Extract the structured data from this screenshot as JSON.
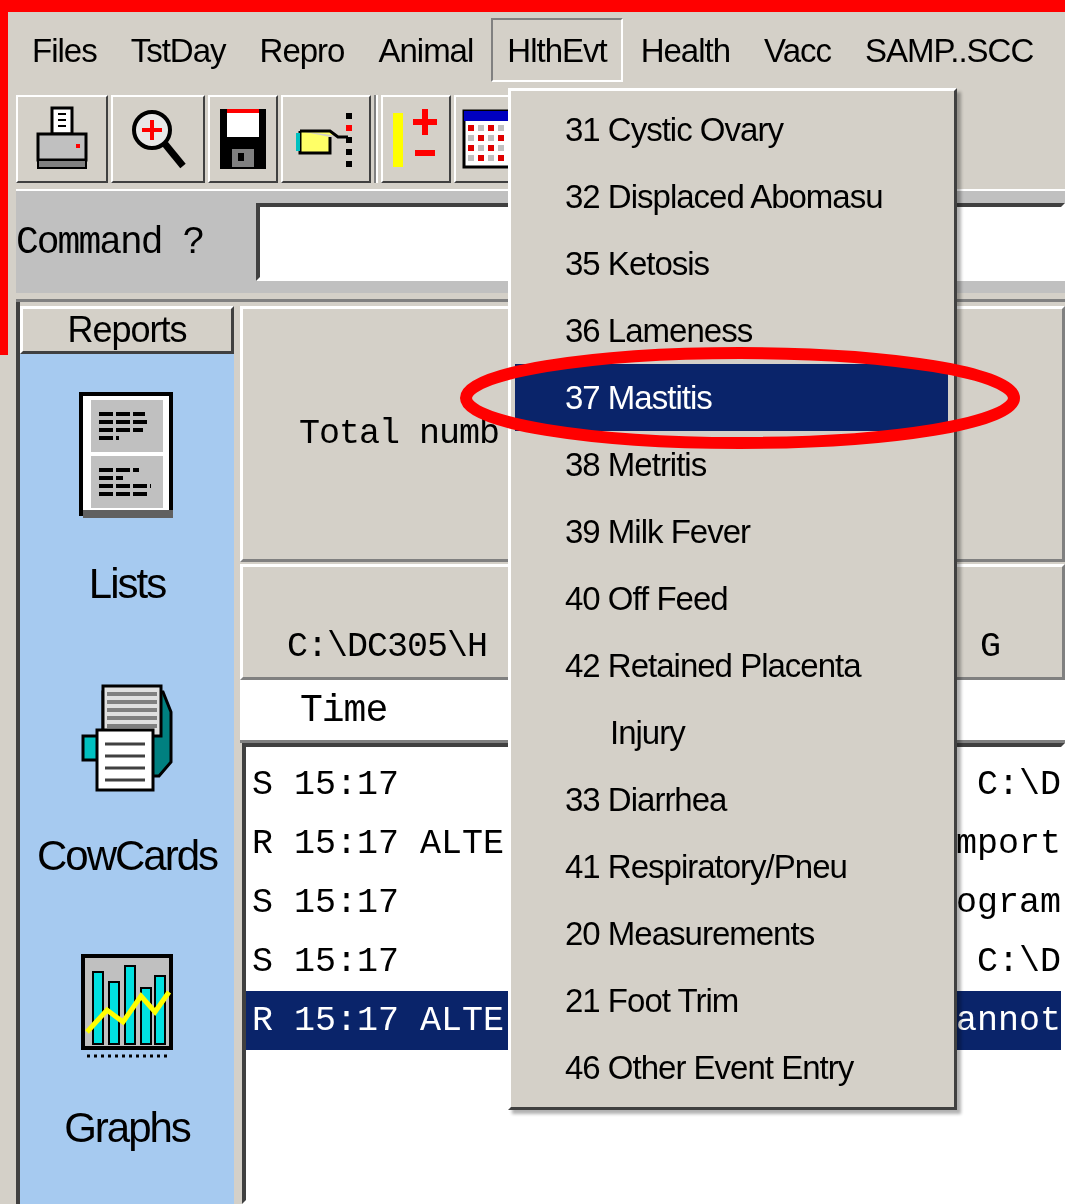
{
  "menu_bar": [
    {
      "label": "Files",
      "selected": false
    },
    {
      "label": "TstDay",
      "selected": false
    },
    {
      "label": "Repro",
      "selected": false
    },
    {
      "label": "Animal",
      "selected": false
    },
    {
      "label": "HlthEvt",
      "selected": true
    },
    {
      "label": "Health",
      "selected": false
    },
    {
      "label": "Vacc",
      "selected": false
    },
    {
      "label": "SAMP..SCC",
      "selected": false
    }
  ],
  "command": {
    "label": "Command ?"
  },
  "sidebar": {
    "header": "Reports",
    "items": [
      {
        "label": "Lists"
      },
      {
        "label": "CowCards"
      },
      {
        "label": "Graphs"
      }
    ]
  },
  "summary": {
    "text": "Total numb"
  },
  "path_bar": {
    "left": "C:\\DC305\\H",
    "right": "G"
  },
  "log": {
    "header": "Time",
    "rows": [
      {
        "left": "S 15:17",
        "right": "C:\\D",
        "selected": false
      },
      {
        "left": "R 15:17 ALTE",
        "right": "mport",
        "selected": false
      },
      {
        "left": "S 15:17",
        "right": "ogram",
        "selected": false
      },
      {
        "left": "S 15:17",
        "right": "C:\\D",
        "selected": false
      },
      {
        "left": "R 15:17 ALTE",
        "right": "annot",
        "selected": true
      }
    ]
  },
  "dropdown": {
    "items": [
      {
        "label": "31 Cystic Ovary",
        "kind": "entry",
        "selected": false
      },
      {
        "label": "32 Displaced Abomasu",
        "kind": "entry",
        "selected": false
      },
      {
        "label": "35 Ketosis",
        "kind": "entry",
        "selected": false
      },
      {
        "label": "36 Lameness",
        "kind": "entry",
        "selected": false
      },
      {
        "label": "37 Mastitis",
        "kind": "entry",
        "selected": true
      },
      {
        "label": "38 Metritis",
        "kind": "entry",
        "selected": false
      },
      {
        "label": "39 Milk Fever",
        "kind": "entry",
        "selected": false
      },
      {
        "label": "40 Off Feed",
        "kind": "entry",
        "selected": false
      },
      {
        "label": "42 Retained Placenta",
        "kind": "entry",
        "selected": false
      },
      {
        "label": "Injury",
        "kind": "indented",
        "selected": false
      },
      {
        "label": "33 Diarrhea",
        "kind": "entry",
        "selected": false
      },
      {
        "label": "41 Respiratory/Pneu",
        "kind": "entry",
        "selected": false
      },
      {
        "label": "20 Measurements",
        "kind": "entry",
        "selected": false
      },
      {
        "label": "21 Foot Trim",
        "kind": "entry",
        "selected": false
      },
      {
        "label": "46 Other Event Entry",
        "kind": "entry",
        "selected": false
      }
    ]
  },
  "annotation": {
    "kind": "ellipse"
  }
}
